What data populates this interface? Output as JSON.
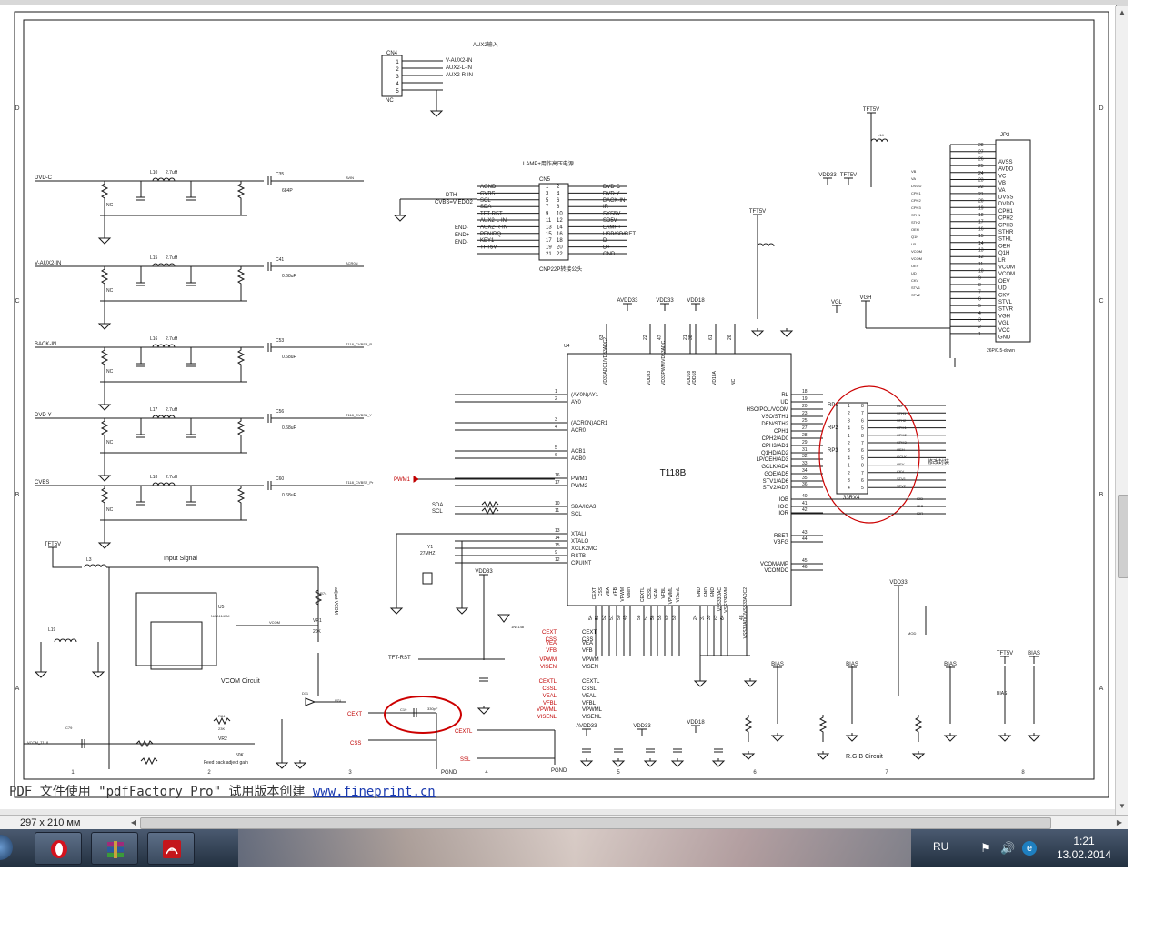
{
  "viewer": {
    "page_size": "297 x 210 мм",
    "watermark_text": "PDF 文件使用 \"pdfFactory Pro\" 试用版本创建 ",
    "watermark_link": "www.fineprint.cn"
  },
  "schematic": {
    "border_rows": [
      "D",
      "C",
      "B",
      "A"
    ],
    "border_cols": [
      "1",
      "2",
      "3",
      "4",
      "5",
      "6",
      "7",
      "8"
    ],
    "aux2": {
      "title": "AUX2输入",
      "ref": "CN4",
      "pins": [
        "1",
        "2",
        "3",
        "4",
        "5"
      ],
      "nets": [
        "V-AUX2-IN",
        "AUX2-L-IN",
        "AUX2-R-IN"
      ],
      "nc": "NC"
    },
    "cn5": {
      "title": "LAMP+用作高压电源",
      "ref": "CN5",
      "footer": "CNP22P转接公头",
      "left_labels": [
        "AGND",
        "CVBS",
        "SCL",
        "SDA",
        "TFT-RST",
        "AUX2-L-IN",
        "AUX2-R-IN",
        "PENIRQ",
        "KEY1",
        "TFT5V"
      ],
      "right_labels": [
        "DVD-C",
        "DVD-Y",
        "BACK-IN",
        "IR",
        "SYS5V",
        "SD5V",
        "LAMP+",
        "USB/SD/DET",
        "D-",
        "D+",
        "GND"
      ],
      "ext_left": [
        "DTH",
        "CVBS=VIEDO2",
        "END-",
        "END+",
        "END-"
      ]
    },
    "filters": [
      {
        "name": "DVD-C",
        "inductor": "L10",
        "ind_val": "2.7uH",
        "cap_out": "C35",
        "cap_val": "684P",
        "net": "AVIN"
      },
      {
        "name": "V-AUX2-IN",
        "inductor": "L15",
        "ind_val": "2.7uH",
        "cap_out": "C41",
        "cap_val": "0.68uF",
        "net": "ACR0N"
      },
      {
        "name": "BACK-IN",
        "inductor": "L16",
        "ind_val": "2.7uH",
        "cap_out": "C53",
        "cap_val": "0.68uF",
        "net": "T118_CVBS3_P"
      },
      {
        "name": "DVD-Y",
        "inductor": "L17",
        "ind_val": "2.7uH",
        "cap_out": "C56",
        "cap_val": "0.68uF",
        "net": "T118_CVBS1_Y"
      },
      {
        "name": "CVBS",
        "inductor": "L18",
        "ind_val": "2.7uH",
        "cap_out": "C60",
        "cap_val": "0.68uF",
        "net": "T118_CVBS2_Pr"
      }
    ],
    "chip": {
      "ref": "U4",
      "name": "T118B",
      "left_pins": [
        "(AY0N)AY1",
        "AY0",
        "(ACR0N)ACR1",
        "ACR0",
        "ACB1",
        "ACB0",
        "PWM1",
        "PWM2",
        "SDA/ICA3",
        "SCL",
        "XTALI",
        "XTALO",
        "XCLK2MC",
        "RSTB",
        "CPUINT"
      ],
      "left_nums": [
        "1",
        "2",
        "3",
        "4",
        "5",
        "6",
        "16",
        "17",
        "10",
        "11",
        "13",
        "14",
        "15",
        "9",
        "12"
      ],
      "right_pins": [
        "RL",
        "UD",
        "HSO/POL/VCOM",
        "VSO/STH1",
        "DEN/STH2",
        "CPH1",
        "CPH2/AD0",
        "CPH3/AD1",
        "Q1HD/AD2",
        "LP/OEH/AD3",
        "GCLK/AD4",
        "GOE/AD5",
        "STV1/AD6",
        "STV2/AD7",
        "IOB",
        "IOG",
        "IOR",
        "RSET",
        "VBFG",
        "VCOMAMP",
        "VCOMDC"
      ],
      "right_nums": [
        "18",
        "19",
        "20",
        "23",
        "25",
        "27",
        "28",
        "29",
        "31",
        "32",
        "33",
        "34",
        "35",
        "36",
        "40",
        "41",
        "42",
        "43",
        "44",
        "45",
        "46"
      ],
      "top_pins": [
        "VD33ADC1/VD33ADC2",
        "VDD33",
        "VD33PWM/VD33ADC",
        "VDD18",
        "VDD18",
        "VD18A",
        "NC"
      ],
      "top_nums": [
        "63",
        "22",
        "47",
        "21",
        "38",
        "61",
        "26"
      ],
      "bottom_pins": [
        "CEXT",
        "CSS",
        "VEA",
        "VFB",
        "VPWM",
        "Visen",
        "CEXTL",
        "CSSL",
        "VEAL",
        "VFBL",
        "VPWML",
        "VISenL",
        "GND",
        "GND",
        "GND",
        "VSS33DAC",
        "VSS33PWM",
        "VSS33ADC/VSS33ADC2"
      ],
      "bottom_nums": [
        "54",
        "53",
        "52",
        "51",
        "50",
        "49",
        "58",
        "57",
        "56",
        "55",
        "60",
        "59",
        "24",
        "37",
        "39",
        "62",
        "64",
        "48"
      ]
    },
    "jp2": {
      "ref": "JP2",
      "footer": "26P/0.5-down",
      "pins": [
        "AVSS",
        "AVDD",
        "VC",
        "VB",
        "VA",
        "DVSS",
        "DVDD",
        "CPH1",
        "CPH2",
        "CPH3",
        "STHR",
        "STHL",
        "OEH",
        "Q1H",
        "LR",
        "VCOM",
        "VCOM",
        "OEV",
        "UD",
        "CKV",
        "STVL",
        "STVR",
        "VGH",
        "VGL",
        "VCC",
        "GND"
      ],
      "nums": [
        "28",
        "27",
        "26",
        "25",
        "24",
        "23",
        "22",
        "21",
        "20",
        "19",
        "18",
        "17",
        "16",
        "15",
        "14",
        "13",
        "12",
        "11",
        "10",
        "9",
        "8",
        "7",
        "6",
        "5",
        "4",
        "3",
        "2",
        "1"
      ]
    },
    "rp": {
      "refs": [
        "RP1",
        "RP2",
        "RP3"
      ],
      "value": "33RX4",
      "note": "修改封装",
      "lr_nets": [
        "UD",
        "STH1",
        "STH2",
        "CPH1",
        "CPH2",
        "CPH3",
        "OEH",
        "GCLK",
        "OEV",
        "CKV",
        "STV1",
        "STV2"
      ]
    },
    "supplies": {
      "tft5v": "TFT5V",
      "vdd33": "VDD33",
      "avdd33": "AVDD33",
      "vdd18": "VDD18",
      "vgl": "VGL",
      "vgh": "VGH",
      "bias": "BIAS",
      "pgnd": "PGND"
    },
    "blocks": {
      "input_signal": "Input Signal",
      "vcom_circuit": "VCOM Circuit",
      "rgb_circuit": "R.G.B Circuit",
      "feedback": "Feed back adject gain",
      "vcom_t118": "VCOM_T118",
      "pwm1": "PWM1",
      "cext": "CEXT",
      "css": "CSS",
      "cextl": "CEXTL",
      "ssl": "SSL",
      "tft_rst": "TFT-RST",
      "vr_label": "adjust VCOM"
    },
    "side_nets": [
      "CEXT",
      "CSS",
      "VEA",
      "VFB",
      "VPWM",
      "VISEN",
      "CEXTL",
      "CSSL",
      "VEAL",
      "VFBL",
      "VPWML",
      "VISENL"
    ],
    "parts": {
      "y1": "Y1",
      "y1_val": "27MHZ",
      "u5": "U5",
      "u5_name": "NJM4141M",
      "vr1": "VR1",
      "vr1_val": "20K",
      "vr2": "VR2",
      "vr2_val": "50K",
      "d11": "D11",
      "c28": "C28",
      "c28_val": "330pF",
      "c19": "C19",
      "d_val": "1N4148"
    }
  }
}
